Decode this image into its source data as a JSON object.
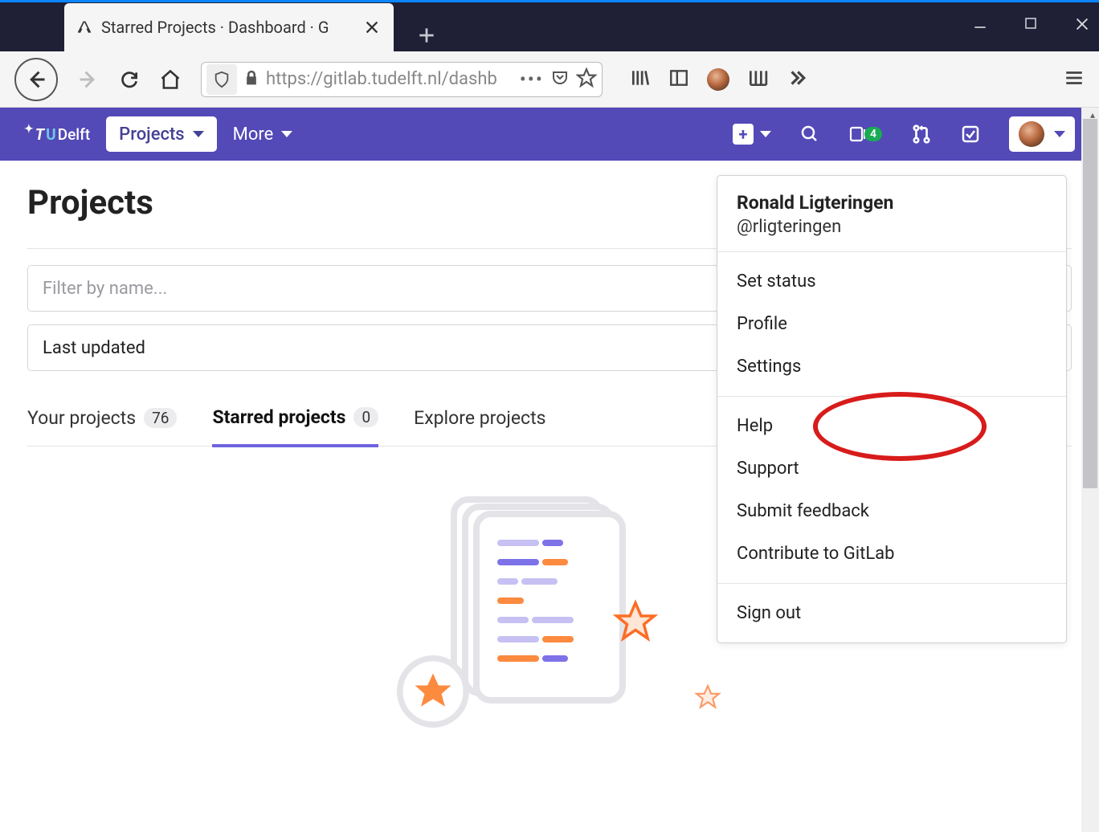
{
  "browser": {
    "tab_title": "Starred Projects · Dashboard · G",
    "url_display": "https://gitlab.tudelft.nl/dashb"
  },
  "gitlab": {
    "logo_text": "TUDelft",
    "projects_btn": "Projects",
    "more_btn": "More",
    "issues_badge": "4"
  },
  "page": {
    "title": "Projects",
    "filter_placeholder": "Filter by name...",
    "sort_label": "Last updated"
  },
  "tabs": [
    {
      "label": "Your projects",
      "count": "76",
      "active": false
    },
    {
      "label": "Starred projects",
      "count": "0",
      "active": true
    },
    {
      "label": "Explore projects",
      "count": null,
      "active": false
    }
  ],
  "user_menu": {
    "name": "Ronald Ligteringen",
    "handle": "@rligteringen",
    "group1": [
      "Set status",
      "Profile",
      "Settings"
    ],
    "group2": [
      "Help",
      "Support",
      "Submit feedback",
      "Contribute to GitLab"
    ],
    "group3": [
      "Sign out"
    ]
  }
}
